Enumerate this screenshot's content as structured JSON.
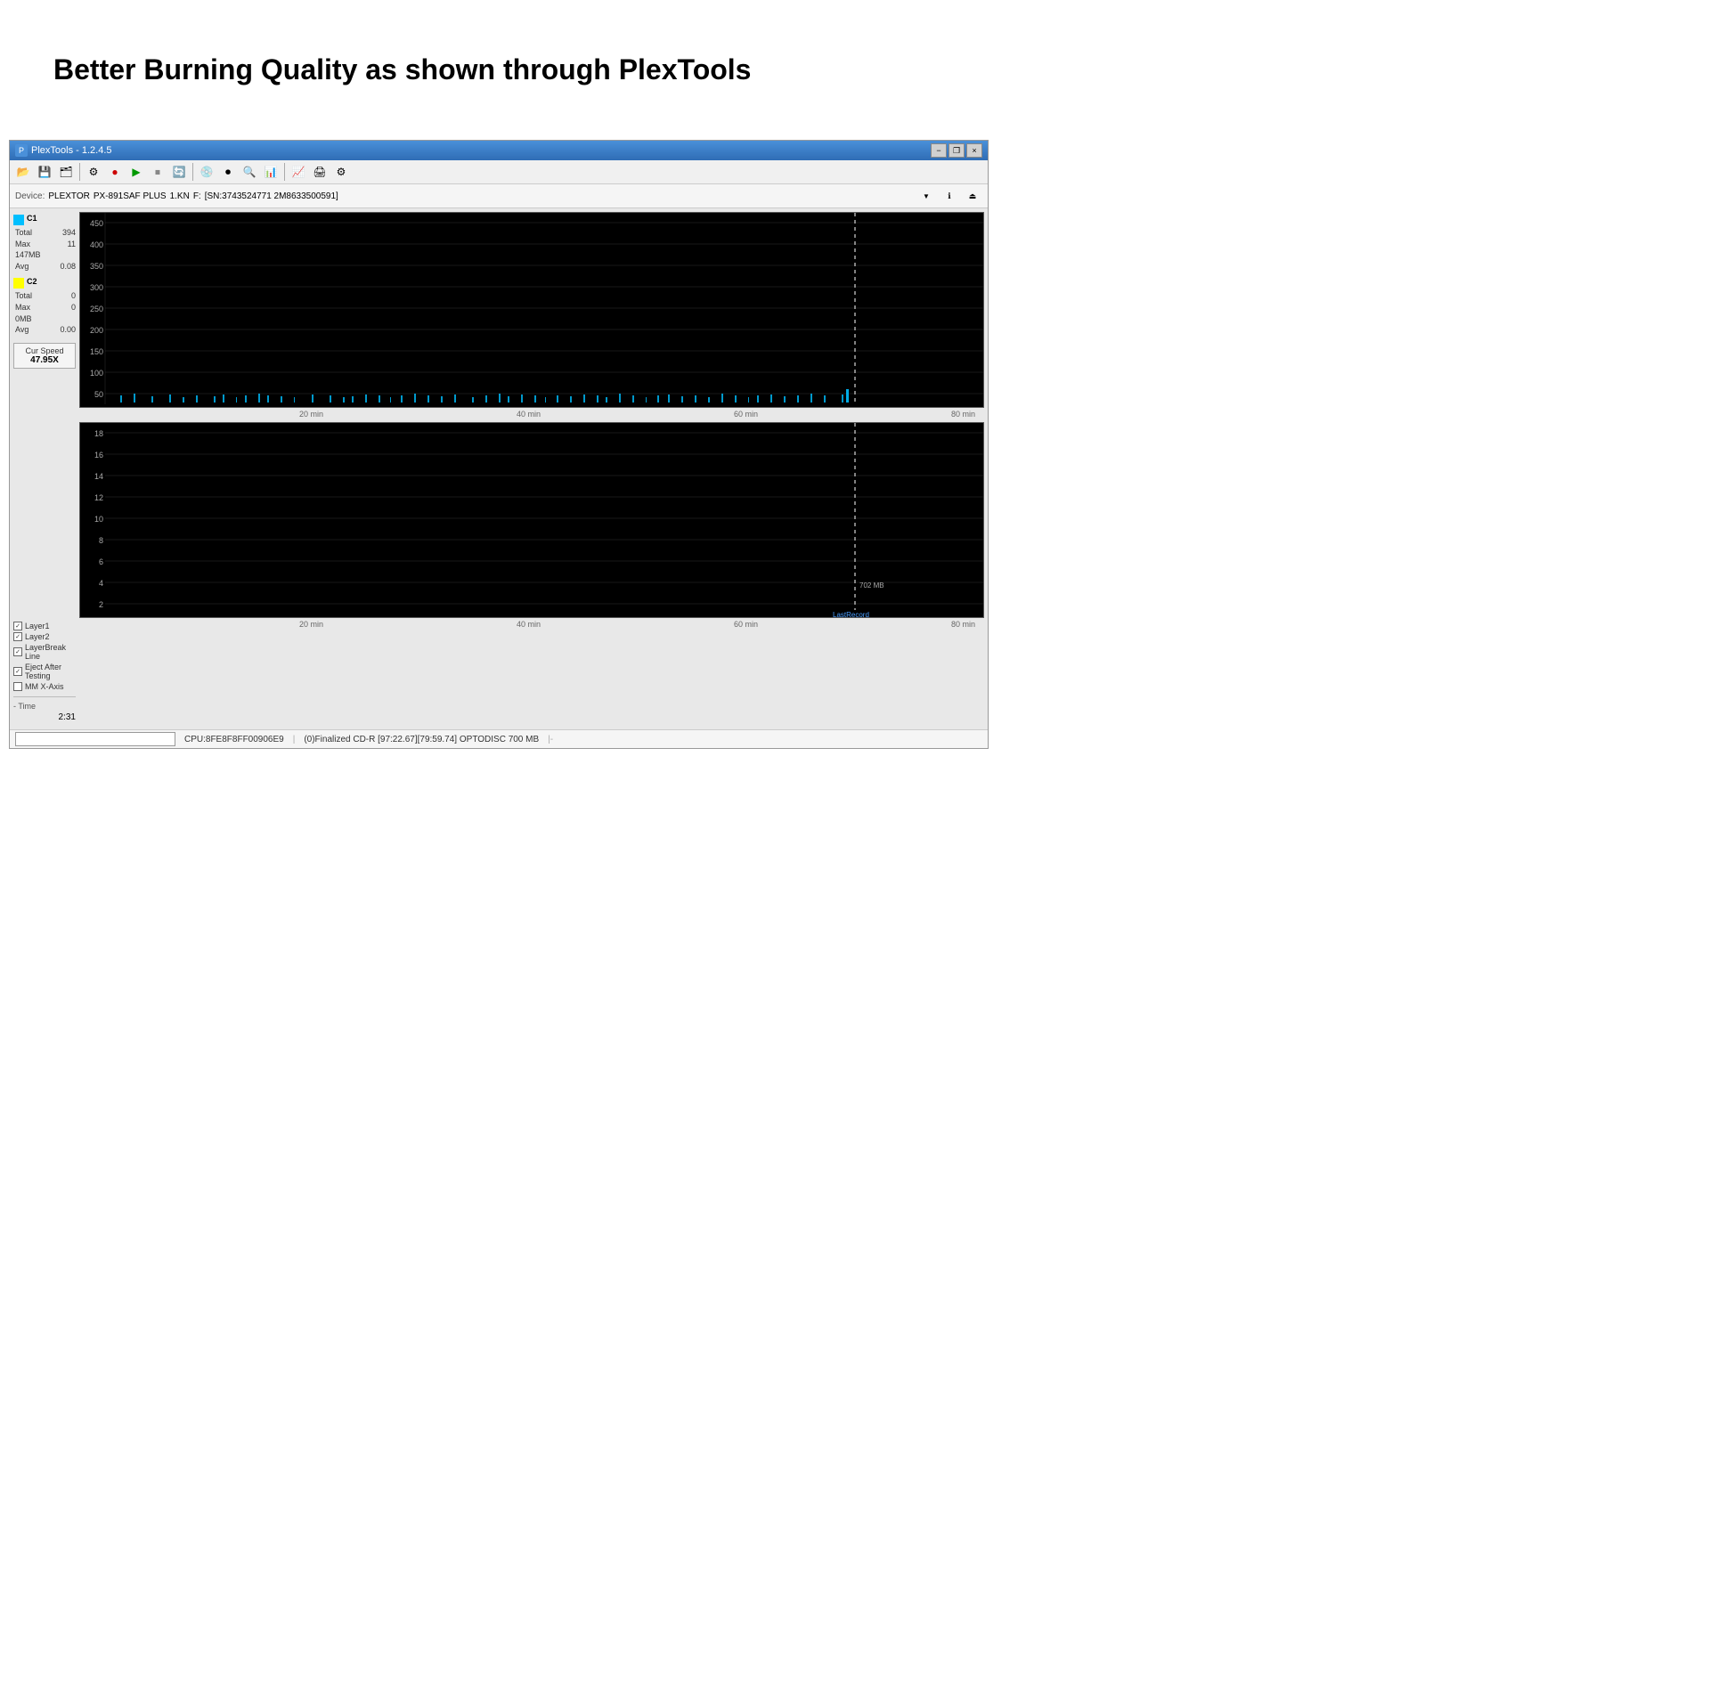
{
  "page": {
    "title": "Better Burning Quality as shown through PlexTools"
  },
  "app": {
    "title": "PlexTools - 1.2.4.5",
    "title_bar_buttons": {
      "minimize": "−",
      "restore": "❐",
      "close": "×"
    }
  },
  "device_bar": {
    "label": "Device:",
    "device_name": "PLEXTOR",
    "model": "PX-891SAF PLUS",
    "speed": "1.KN",
    "drive_letter": "F:",
    "serial": "[SN:3743524771 2M8633500591]"
  },
  "toolbar": {
    "buttons": [
      "🗂",
      "💾",
      "📂",
      "🖨",
      "⚙",
      "▶",
      "⏹",
      "🔄",
      "💿",
      "⏺",
      "🔍",
      "📊",
      "📈",
      "⚙"
    ]
  },
  "c1": {
    "label": "C1",
    "color": "#00bfff",
    "stats": {
      "total_label": "Total",
      "total_value": "394",
      "max_label": "Max",
      "max_value": "11",
      "size_value": "147MB",
      "avg_label": "Avg",
      "avg_value": "0.08"
    }
  },
  "c2": {
    "label": "C2",
    "color": "#ffff00",
    "stats": {
      "total_label": "Total",
      "total_value": "0",
      "max_label": "Max",
      "max_value": "0",
      "size_value": "0MB",
      "avg_label": "Avg",
      "avg_value": "0.00"
    }
  },
  "cur_speed": {
    "label": "Cur Speed",
    "value": "47.95X"
  },
  "top_chart": {
    "y_labels": [
      "450",
      "400",
      "350",
      "300",
      "250",
      "200",
      "150",
      "100",
      "50"
    ],
    "x_labels": [
      "20 min",
      "40 min",
      "60 min",
      "80 min"
    ],
    "dotted_line_pos_pct": 88
  },
  "bottom_chart": {
    "y_labels": [
      "18",
      "16",
      "14",
      "12",
      "10",
      "8",
      "6",
      "4",
      "2"
    ],
    "x_labels": [
      "20 min",
      "40 min",
      "60 min",
      "80 min"
    ],
    "dotted_line_pos_pct": 88,
    "mb_label": "702 MB",
    "last_record_label": "LastRecord"
  },
  "sidebar_bottom": {
    "checkboxes": [
      {
        "label": "Layer1",
        "checked": true
      },
      {
        "label": "Layer2",
        "checked": true
      },
      {
        "label": "LayerBreak Line",
        "checked": true
      },
      {
        "label": "Eject After Testing",
        "checked": true
      },
      {
        "label": "MM X-Axis",
        "checked": false
      }
    ],
    "time_label": "- Time",
    "time_value": "2:31"
  },
  "status_bar": {
    "cpu_info": "CPU:8FE8F8FF00906E9",
    "disc_info": "(0)Finalized  CD-R  [97:22.67][79:59.74] OPTODISC  700 MB",
    "separator": "|-"
  }
}
